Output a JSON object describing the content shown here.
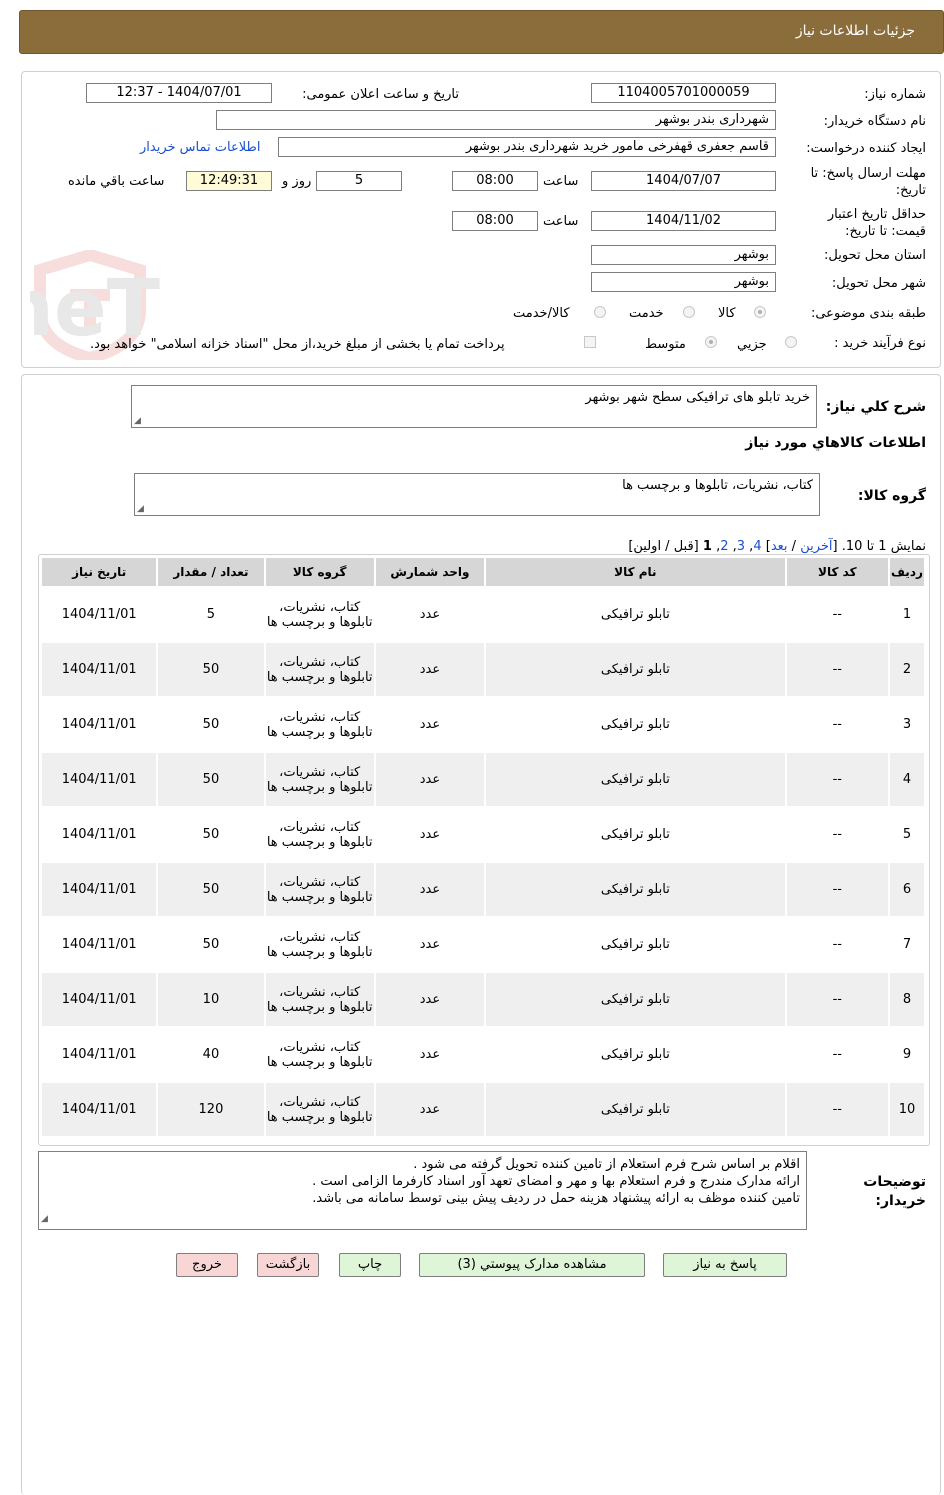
{
  "header": {
    "title": "جزئیات اطلاعات نیاز"
  },
  "form": {
    "need_number_label": "شماره نیاز:",
    "need_number": "1104005701000059",
    "announce_label": "تاریخ و ساعت اعلان عمومی:",
    "announce_value": "1404/07/01 - 12:37",
    "buyer_org_label": "نام دستگاه خریدار:",
    "buyer_org": "شهرداری بندر بوشهر",
    "requester_label": "ایجاد کننده درخواست:",
    "requester": "قاسم جعفری قهفرخی مامور خرید  شهرداری بندر بوشهر",
    "contact_link": "اطلاعات تماس خریدار",
    "reply_deadline_label": "مهلت ارسال پاسخ: تا تاریخ:",
    "reply_date": "1404/07/07",
    "time_label": "ساعت",
    "reply_time": "08:00",
    "days_value": "5",
    "days_label": "روز و",
    "remaining_time": "12:49:31",
    "remaining_label": "ساعت باقي مانده",
    "validity_label": "حداقل تاریخ اعتبار قیمت: تا تاریخ:",
    "validity_date": "1404/11/02",
    "validity_time": "08:00",
    "province_label": "استان محل تحویل:",
    "province": "بوشهر",
    "city_label": "شهر محل تحویل:",
    "city": "بوشهر",
    "category_label": "طبقه بندی موضوعی:",
    "category_options": [
      "کالا",
      "خدمت",
      "کالا/خدمت"
    ],
    "process_label": "نوع فرآیند خرید :",
    "process_options": [
      "جزيي",
      "متوسط"
    ],
    "payment_note": "پرداخت تمام یا بخشی از مبلغ خرید،از محل \"اسناد خزانه اسلامی\" خواهد بود."
  },
  "watermark": {
    "text": "AriaTender.neT"
  },
  "description": {
    "label": "شرح کلي نياز:",
    "value": "خرید تابلو  های ترافیکی سطح شهر بوشهر"
  },
  "goods": {
    "section_title": "اطلاعات کالاهاي مورد نياز",
    "group_label": "گروه کالا:",
    "group_value": "کتاب، نشریات، تابلوها و برچسب ها"
  },
  "pagination": {
    "show": "نمایش 1 تا 10.",
    "open_bracket": "[",
    "last": "آخرین",
    "slash1": "/",
    "next": "بعد",
    "close_bracket": "]",
    "p4": "4",
    "p3": "3",
    "p2": "2",
    "p1": "1",
    "prev_first": "[قبل / اولین]"
  },
  "table": {
    "headers": [
      "ردیف",
      "کد کالا",
      "نام کالا",
      "واحد شمارش",
      "گروه کالا",
      "تعداد / مقدار",
      "تاریخ نیاز"
    ],
    "rows": [
      {
        "n": "1",
        "code": "--",
        "name": "تابلو ترافیکی",
        "unit": "عدد",
        "group": "کتاب، نشریات، تابلوها و برچسب ها",
        "qty": "5",
        "date": "1404/11/01"
      },
      {
        "n": "2",
        "code": "--",
        "name": "تابلو ترافیکی",
        "unit": "عدد",
        "group": "کتاب، نشریات، تابلوها و برچسب ها",
        "qty": "50",
        "date": "1404/11/01"
      },
      {
        "n": "3",
        "code": "--",
        "name": "تابلو ترافیکی",
        "unit": "عدد",
        "group": "کتاب، نشریات، تابلوها و برچسب ها",
        "qty": "50",
        "date": "1404/11/01"
      },
      {
        "n": "4",
        "code": "--",
        "name": "تابلو ترافیکی",
        "unit": "عدد",
        "group": "کتاب، نشریات، تابلوها و برچسب ها",
        "qty": "50",
        "date": "1404/11/01"
      },
      {
        "n": "5",
        "code": "--",
        "name": "تابلو ترافیکی",
        "unit": "عدد",
        "group": "کتاب، نشریات، تابلوها و برچسب ها",
        "qty": "50",
        "date": "1404/11/01"
      },
      {
        "n": "6",
        "code": "--",
        "name": "تابلو ترافیکی",
        "unit": "عدد",
        "group": "کتاب، نشریات، تابلوها و برچسب ها",
        "qty": "50",
        "date": "1404/11/01"
      },
      {
        "n": "7",
        "code": "--",
        "name": "تابلو ترافیکی",
        "unit": "عدد",
        "group": "کتاب، نشریات، تابلوها و برچسب ها",
        "qty": "50",
        "date": "1404/11/01"
      },
      {
        "n": "8",
        "code": "--",
        "name": "تابلو ترافیکی",
        "unit": "عدد",
        "group": "کتاب، نشریات، تابلوها و برچسب ها",
        "qty": "10",
        "date": "1404/11/01"
      },
      {
        "n": "9",
        "code": "--",
        "name": "تابلو ترافیکی",
        "unit": "عدد",
        "group": "کتاب، نشریات، تابلوها و برچسب ها",
        "qty": "40",
        "date": "1404/11/01"
      },
      {
        "n": "10",
        "code": "--",
        "name": "تابلو ترافیکی",
        "unit": "عدد",
        "group": "کتاب، نشریات، تابلوها و برچسب ها",
        "qty": "120",
        "date": "1404/11/01"
      }
    ]
  },
  "notes": {
    "label": "توضیحات خریدار:",
    "lines": [
      "اقلام بر اساس شرح فرم استعلام از تامین کننده تحویل گرفته می شود .",
      "ارائه مدارک مندرج و فرم استعلام بها و مهر و امضای تعهد آور اسناد کارفرما الزامی است .",
      "تامین  کننده موظف به ارائه پیشنهاد هزینه حمل در ردیف پیش بینی توسط سامانه می باشد."
    ]
  },
  "buttons": {
    "reply": "پاسخ به نياز",
    "attachments": "مشاهده مدارک پیوستي (3)",
    "print": "چاپ",
    "back": "بازگشت",
    "exit": "خروج"
  }
}
